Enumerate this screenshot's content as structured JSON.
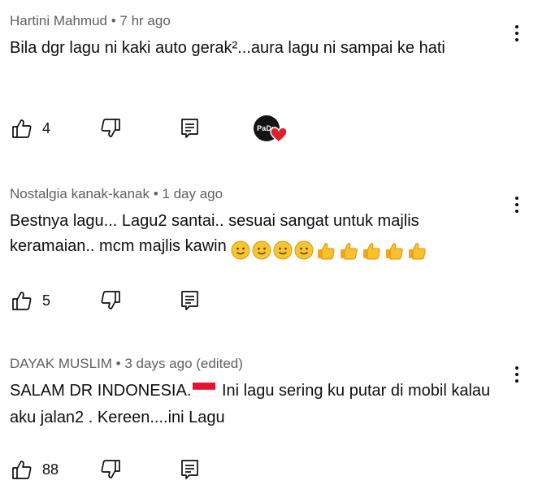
{
  "comments": [
    {
      "author": "Hartini Mahmud",
      "time": "7 hr ago",
      "text": "Bila dgr lagu ni kaki auto gerak²...aura lagu ni sampai ke hati",
      "likes": "4",
      "creator_badge": "PaDu"
    },
    {
      "author": "Nostalgia kanak-kanak",
      "time": "1 day ago",
      "text": "Bestnya lagu... Lagu2 santai.. sesuai sangat untuk majlis keramaian.. mcm majlis kawin",
      "emojis": [
        "slightly-smiling-face",
        "slightly-smiling-face",
        "slightly-smiling-face",
        "slightly-smiling-face",
        "thumbs-up",
        "thumbs-up",
        "thumbs-up",
        "thumbs-up",
        "thumbs-up"
      ],
      "likes": "5"
    },
    {
      "author": "DAYAK MUSLIM",
      "time": "3 days ago (edited)",
      "text_before_flag": "SALAM DR INDONESIA.",
      "flag": "indonesia-flag",
      "text_after_flag": " Ini lagu sering ku putar di mobil kalau aku jalan2 . Kereen....ini Lagu",
      "likes": "88"
    }
  ],
  "separator": " • "
}
